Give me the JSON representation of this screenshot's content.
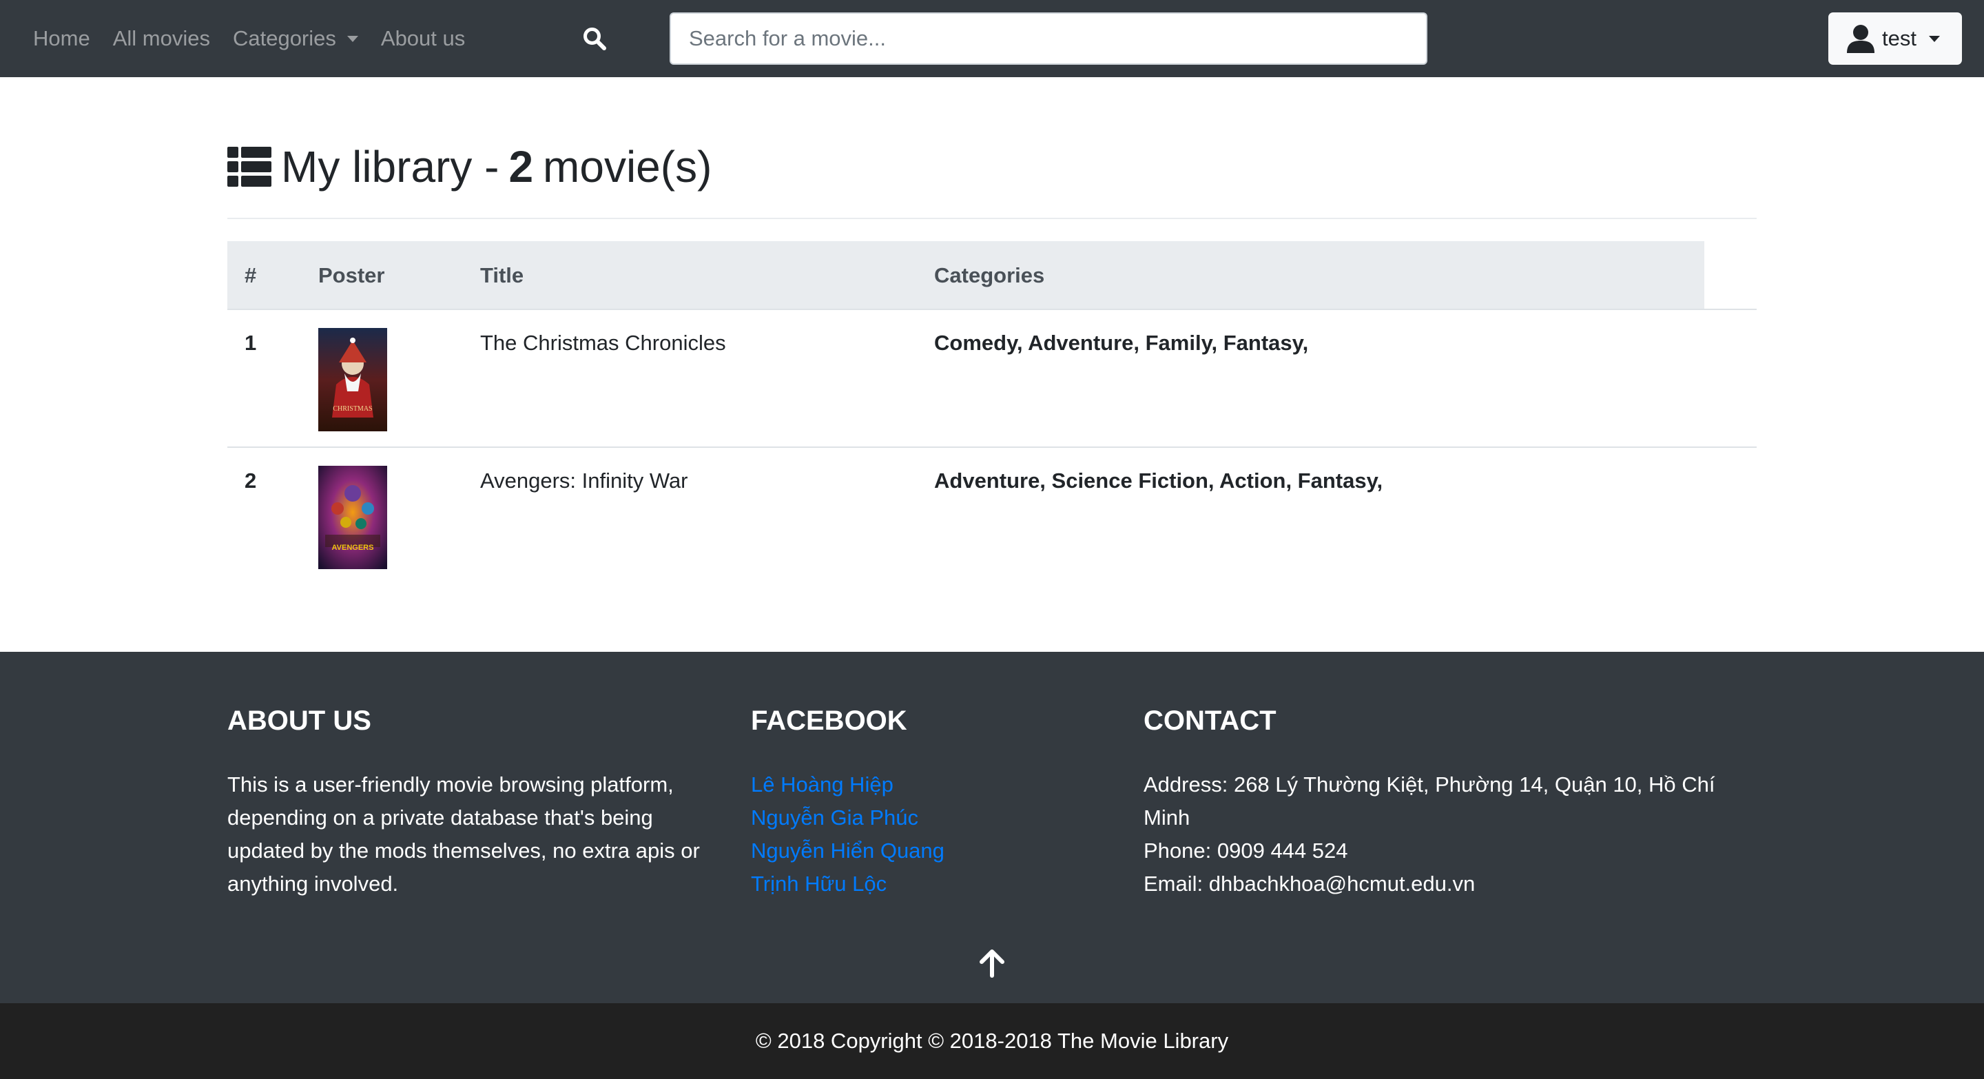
{
  "nav": {
    "links": [
      "Home",
      "All movies",
      "Categories",
      "About us"
    ],
    "search_placeholder": "Search for a movie...",
    "user_name": "test"
  },
  "library": {
    "title_prefix": "My library -",
    "count": "2",
    "title_suffix": "movie(s)",
    "columns": [
      "#",
      "Poster",
      "Title",
      "Categories"
    ],
    "rows": [
      {
        "num": "1",
        "title": "The Christmas Chronicles",
        "categories": "Comedy, Adventure, Family, Fantasy,",
        "poster_caption": "CHRISTMAS"
      },
      {
        "num": "2",
        "title": "Avengers: Infinity War",
        "categories": "Adventure, Science Fiction, Action, Fantasy,",
        "poster_caption": "AVENGERS"
      }
    ]
  },
  "footer": {
    "about": {
      "heading": "About us",
      "text": "This is a user-friendly movie browsing platform, depending on a private database that's being updated by the mods themselves, no extra apis or anything involved."
    },
    "facebook": {
      "heading": "Facebook",
      "links": [
        "Lê Hoàng Hiệp",
        "Nguyễn Gia Phúc",
        "Nguyễn Hiển Quang",
        "Trịnh Hữu Lộc"
      ]
    },
    "contact": {
      "heading": "Contact",
      "address": "Address: 268 Lý Thường Kiệt, Phường 14, Quận 10, Hồ Chí Minh",
      "phone": "Phone: 0909 444 524",
      "email": "Email: dhbachkhoa@hcmut.edu.vn"
    },
    "copyright": "© 2018 Copyright © 2018-2018 The Movie Library"
  },
  "colors": {
    "navbar": "#343a40",
    "footer": "#343a40",
    "copyright_bar": "#212121",
    "link": "#007bff",
    "table_head": "#e9ecef"
  }
}
